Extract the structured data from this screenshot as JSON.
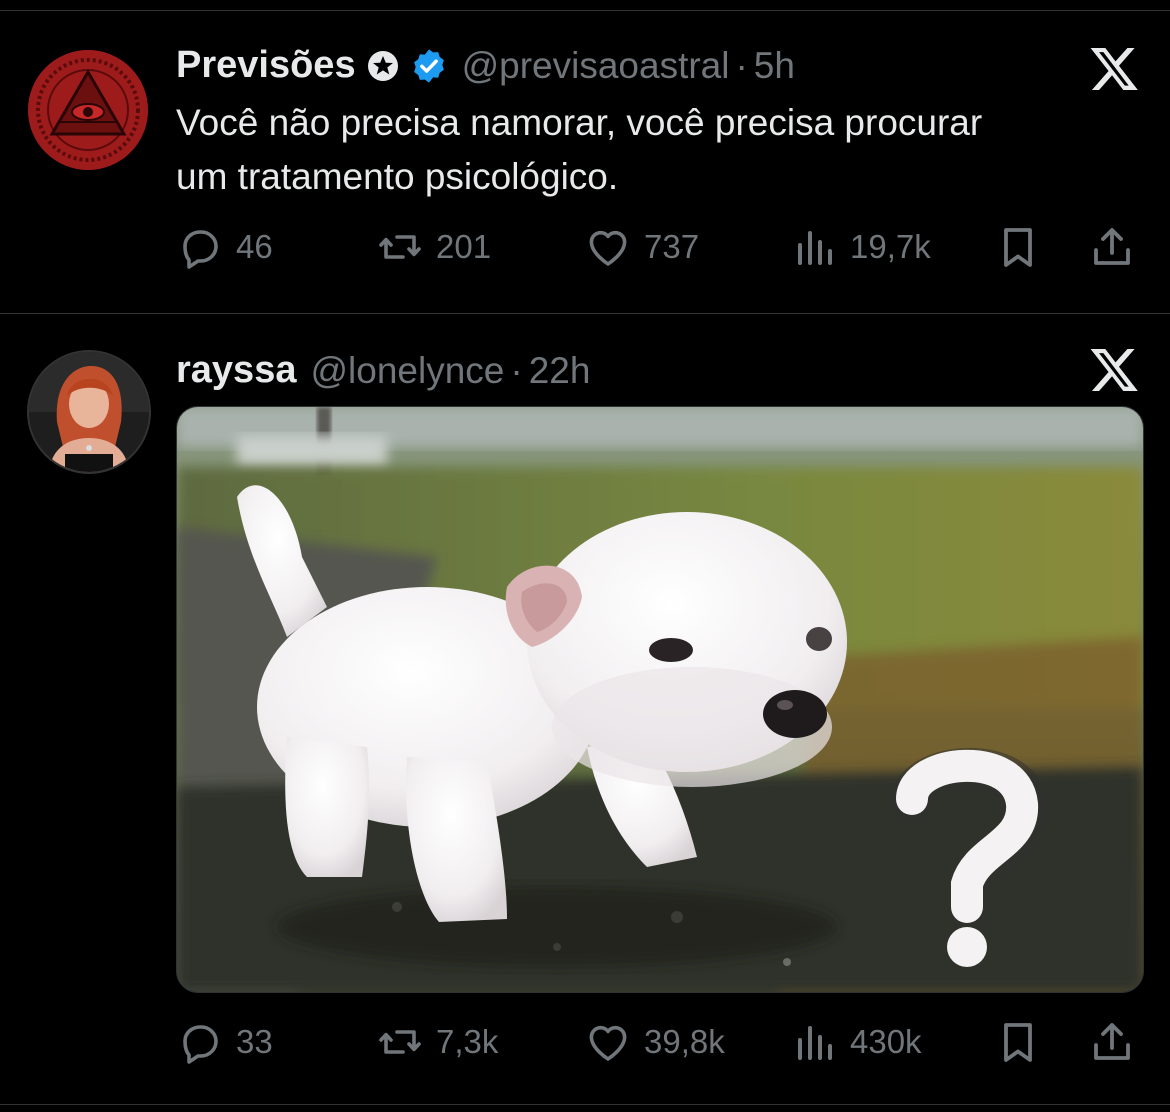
{
  "tweets": [
    {
      "name": "Previsões",
      "handle": "@previsaoastral",
      "separator": "·",
      "time": "5h",
      "text_lines": [
        "Você não precisa namorar, você precisa procurar",
        "um tratamento psicológico."
      ],
      "replies": "46",
      "reposts": "201",
      "likes": "737",
      "views": "19,7k"
    },
    {
      "name": "rayssa",
      "handle": "@lonelynce",
      "separator": "·",
      "time": "22h",
      "replies": "33",
      "reposts": "7,3k",
      "likes": "39,8k",
      "views": "430k"
    }
  ],
  "colors": {
    "background": "#000000",
    "text": "#e7e9ea",
    "muted": "#71767b",
    "verified": "#1d9bf0",
    "divider": "#2f3336"
  },
  "icons": [
    "reply-icon",
    "repost-icon",
    "like-icon",
    "views-icon",
    "bookmark-icon",
    "share-icon",
    "x-logo-icon",
    "verified-badge-icon",
    "star-badge-icon"
  ]
}
